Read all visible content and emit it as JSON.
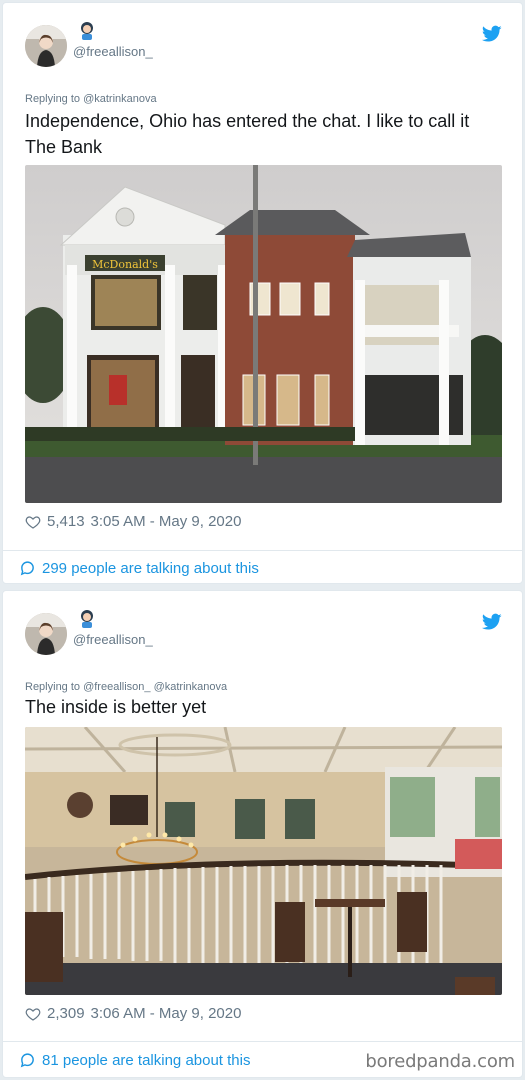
{
  "tweets": [
    {
      "handle": "@freeallison_",
      "replying": "Replying to @katrinkanova",
      "text": "Independence, Ohio has entered the chat. I like to call it The Bank",
      "likes": "5,413",
      "timestamp": "3:05 AM - May 9, 2020",
      "talking": "299 people are talking about this",
      "sign_text": "McDonald's"
    },
    {
      "handle": "@freeallison_",
      "replying": "Replying to @freeallison_ @katrinkanova",
      "text": "The inside is better yet",
      "likes": "2,309",
      "timestamp": "3:06 AM - May 9, 2020",
      "talking": "81 people are talking about this"
    }
  ],
  "watermark": "boredpanda.com",
  "colors": {
    "twitter_blue": "#1da1f2",
    "link_blue": "#1b95e0",
    "muted": "#657786"
  },
  "icons": [
    "twitter-bird-icon",
    "heart-icon",
    "speech-bubble-icon"
  ]
}
